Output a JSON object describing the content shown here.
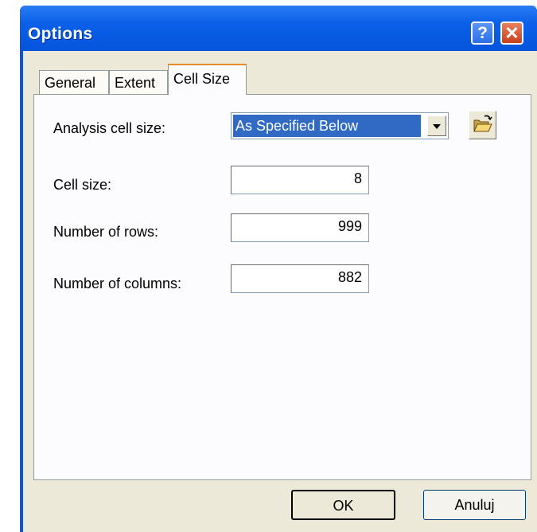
{
  "window": {
    "title": "Options"
  },
  "titlebar_buttons": {
    "help": "?",
    "close": "✕"
  },
  "tabs": [
    {
      "label": "General"
    },
    {
      "label": "Extent"
    },
    {
      "label": "Cell Size"
    }
  ],
  "cell_size_tab": {
    "analysis_cell_size_label": "Analysis cell size:",
    "analysis_cell_size_value": "As Specified Below",
    "cell_size_label": "Cell size:",
    "cell_size_value": "8",
    "rows_label": "Number of rows:",
    "rows_value": "999",
    "columns_label": "Number of columns:",
    "columns_value": "882"
  },
  "icons": {
    "browse": "open-folder-icon",
    "dropdown": "chevron-down-icon"
  },
  "buttons": {
    "ok": "OK",
    "cancel": "Anuluj"
  }
}
